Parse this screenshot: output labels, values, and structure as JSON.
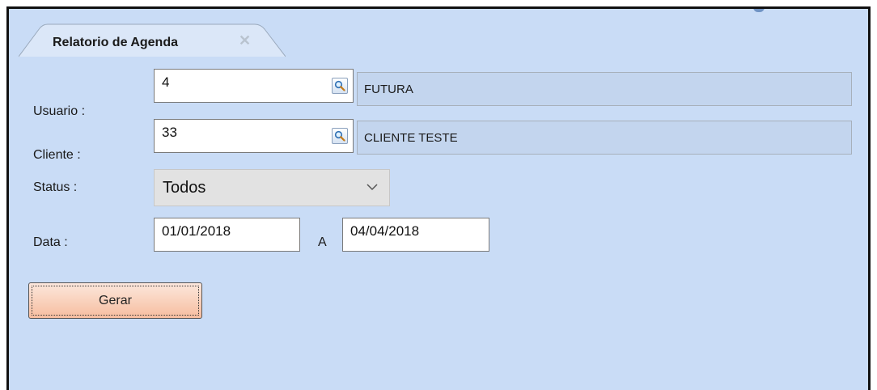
{
  "tab": {
    "title": "Relatorio de Agenda",
    "close_glyph": "✕"
  },
  "form": {
    "usuario": {
      "label": "Usuario :",
      "code": "4",
      "name": "FUTURA"
    },
    "cliente": {
      "label": "Cliente :",
      "code": "33",
      "name": "CLIENTE TESTE"
    },
    "status": {
      "label": "Status :",
      "selected": "Todos"
    },
    "data": {
      "label": "Data :",
      "from": "01/01/2018",
      "separator": "A",
      "to": "04/04/2018"
    }
  },
  "actions": {
    "generate_label": "Gerar"
  },
  "icons": {
    "lookup": "magnifier-icon",
    "dropdown": "chevron-down-icon",
    "close": "close-icon"
  },
  "colors": {
    "panel_background": "#c9dcf6",
    "readonly_background": "#c3d5ee",
    "button_gradient_top": "#fce7dc",
    "button_gradient_bottom": "#f6bd9f",
    "select_background": "#e2e2e2"
  }
}
